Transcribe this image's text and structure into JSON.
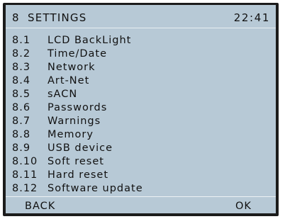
{
  "header": {
    "number": "8",
    "title": "SETTINGS",
    "time": "22:41"
  },
  "menu": {
    "items": [
      {
        "number": "8.1",
        "label": "LCD BackLight"
      },
      {
        "number": "8.2",
        "label": "Time/Date"
      },
      {
        "number": "8.3",
        "label": "Network"
      },
      {
        "number": "8.4",
        "label": "Art-Net"
      },
      {
        "number": "8.5",
        "label": "sACN"
      },
      {
        "number": "8.6",
        "label": "Passwords"
      },
      {
        "number": "8.7",
        "label": "Warnings"
      },
      {
        "number": "8.8",
        "label": "Memory"
      },
      {
        "number": "8.9",
        "label": "USB device"
      },
      {
        "number": "8.10",
        "label": "Soft reset"
      },
      {
        "number": "8.11",
        "label": "Hard reset"
      },
      {
        "number": "8.12",
        "label": "Software update"
      }
    ]
  },
  "footer": {
    "back_label": "BACK",
    "ok_label": "OK"
  },
  "colors": {
    "screen_background": "#b7c9d6",
    "text": "#111111",
    "bezel": "#1c1c1c",
    "divider": "#e8eef2"
  }
}
